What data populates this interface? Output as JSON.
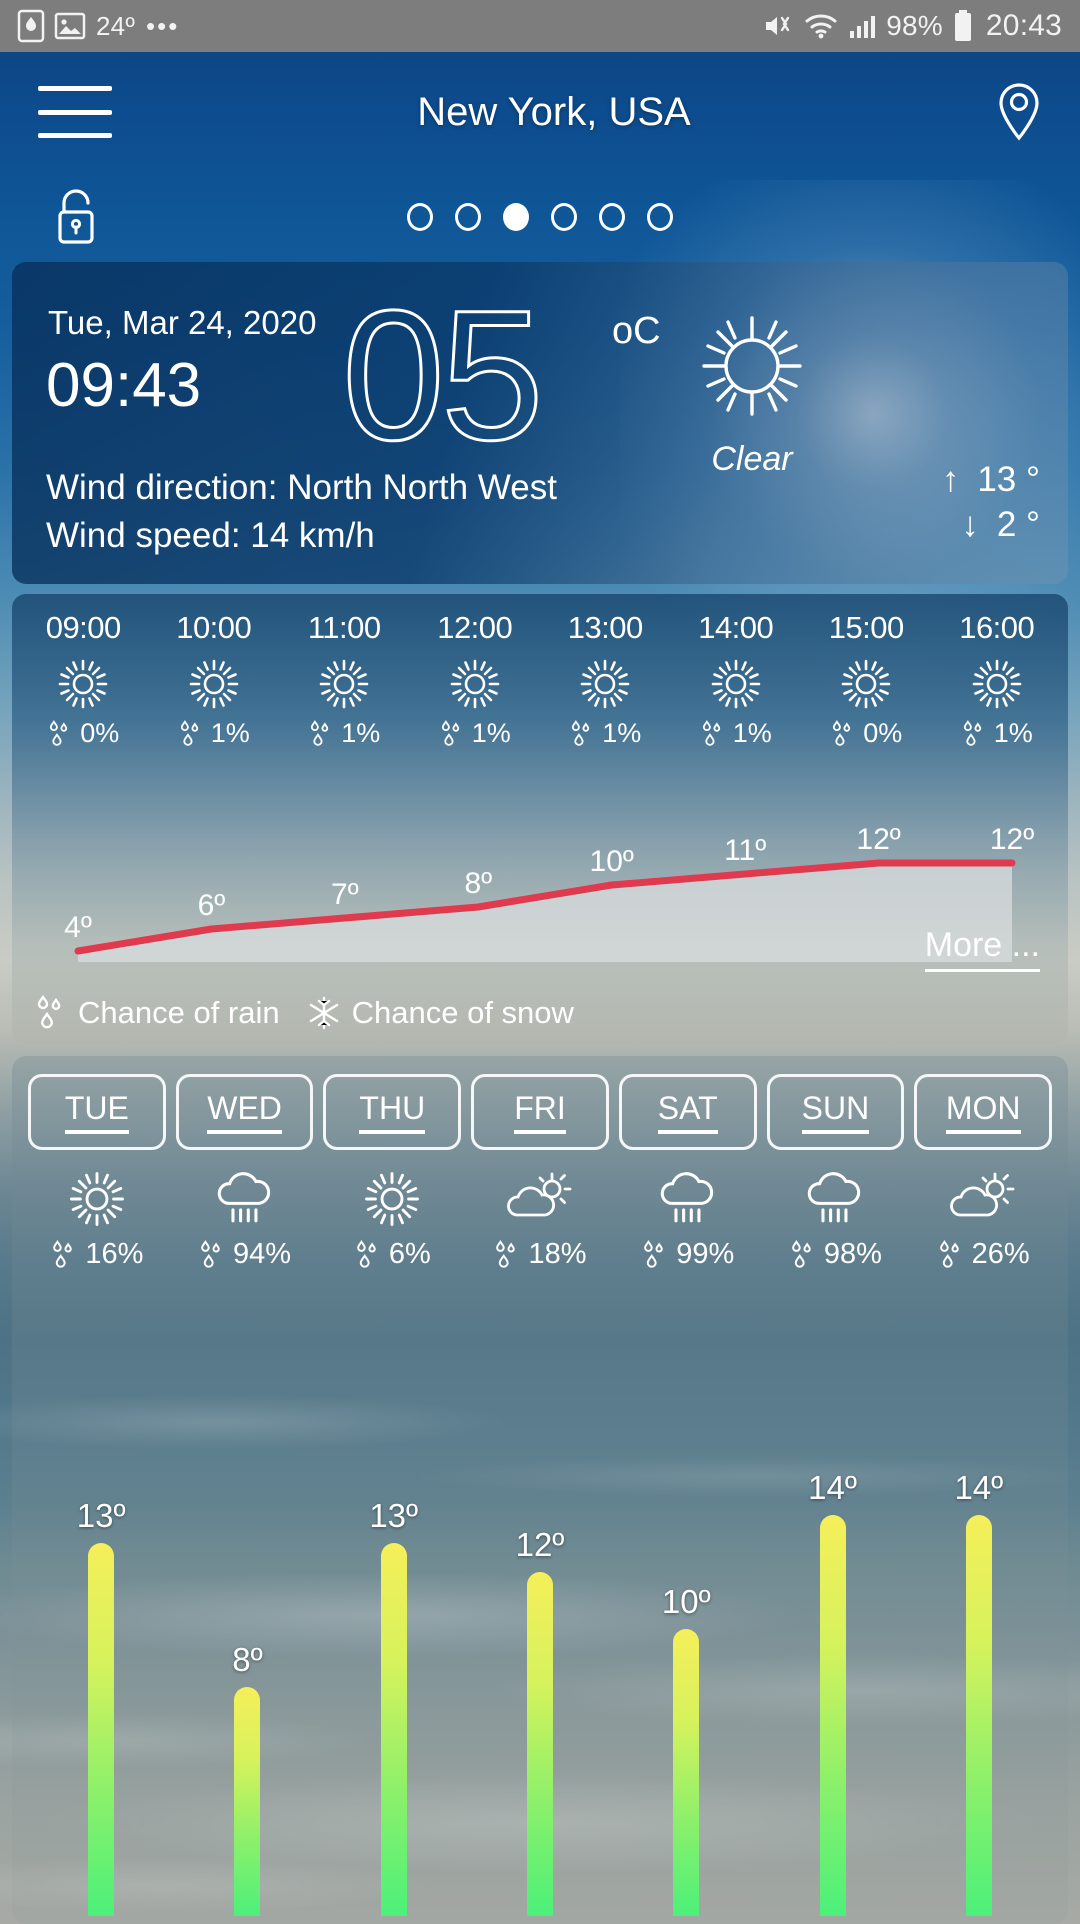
{
  "statusbar": {
    "battery_saver_icon": "battery-saver-icon",
    "photo_icon": "photo-icon",
    "notif_temp": "24º",
    "more_dots": "•••",
    "mute_icon": "volume-mute-icon",
    "wifi_icon": "wifi-icon",
    "signal_icon": "cellular-signal-icon",
    "battery_pct": "98%",
    "battery_icon": "battery-icon",
    "clock": "20:43"
  },
  "header": {
    "menu_icon": "hamburger-menu-icon",
    "title": "New York, USA",
    "location_icon": "location-pin-icon"
  },
  "subrow": {
    "lock_icon": "unlock-icon",
    "page_count": 6,
    "active_page": 3
  },
  "current": {
    "date": "Tue, Mar 24, 2020",
    "time": "09:43",
    "temperature": "05",
    "unit": "oC",
    "condition": "Clear",
    "condition_icon": "sun-icon",
    "wind_direction": "Wind direction: North North West",
    "wind_speed": "Wind speed: 14 km/h",
    "high_arrow": "↑",
    "high": "13 °",
    "low_arrow": "↓",
    "low": "2 °"
  },
  "hourly": {
    "items": [
      {
        "time": "09:00",
        "icon": "sun-icon",
        "rain": "0%"
      },
      {
        "time": "10:00",
        "icon": "sun-icon",
        "rain": "1%"
      },
      {
        "time": "11:00",
        "icon": "sun-icon",
        "rain": "1%"
      },
      {
        "time": "12:00",
        "icon": "sun-icon",
        "rain": "1%"
      },
      {
        "time": "13:00",
        "icon": "sun-icon",
        "rain": "1%"
      },
      {
        "time": "14:00",
        "icon": "sun-icon",
        "rain": "1%"
      },
      {
        "time": "15:00",
        "icon": "sun-icon",
        "rain": "0%"
      },
      {
        "time": "16:00",
        "icon": "sun-icon",
        "rain": "1%"
      }
    ],
    "legend_rain_icon": "raindrops-icon",
    "legend_rain": "Chance of rain",
    "legend_snow_icon": "snowflake-icon",
    "legend_snow": "Chance of snow",
    "more_label": "More ..."
  },
  "weekly": {
    "days": [
      {
        "label": "TUE",
        "icon": "sun-icon",
        "rain": "16%",
        "temp": "13º",
        "value": 13
      },
      {
        "label": "WED",
        "icon": "rain-cloud-icon",
        "rain": "94%",
        "temp": "8º",
        "value": 8
      },
      {
        "label": "THU",
        "icon": "sun-icon",
        "rain": "6%",
        "temp": "13º",
        "value": 13
      },
      {
        "label": "FRI",
        "icon": "sun-cloud-icon",
        "rain": "18%",
        "temp": "12º",
        "value": 12
      },
      {
        "label": "SAT",
        "icon": "rain-cloud-icon",
        "rain": "99%",
        "temp": "10º",
        "value": 10
      },
      {
        "label": "SUN",
        "icon": "rain-cloud-icon",
        "rain": "98%",
        "temp": "14º",
        "value": 14
      },
      {
        "label": "MON",
        "icon": "sun-cloud-icon",
        "rain": "26%",
        "temp": "14º",
        "value": 14
      }
    ]
  },
  "chart_data": [
    {
      "type": "area",
      "title": "Hourly temperature",
      "x": [
        "09:00",
        "10:00",
        "11:00",
        "12:00",
        "13:00",
        "14:00",
        "15:00",
        "16:00"
      ],
      "values": [
        4,
        6,
        7,
        8,
        10,
        11,
        12,
        12
      ],
      "labels": [
        "4º",
        "6º",
        "7º",
        "8º",
        "10º",
        "11º",
        "12º",
        "12º"
      ],
      "line_color": "#e03a4e",
      "fill_color": "#d7dbdc",
      "ylabel": "",
      "xlabel": "",
      "ylim": [
        0,
        14
      ],
      "grid": false,
      "legend": [
        "Chance of rain",
        "Chance of snow"
      ]
    },
    {
      "type": "bar",
      "title": "7-day high temperature",
      "categories": [
        "TUE",
        "WED",
        "THU",
        "FRI",
        "SAT",
        "SUN",
        "MON"
      ],
      "values": [
        13,
        8,
        13,
        12,
        10,
        14,
        14
      ],
      "labels": [
        "13º",
        "8º",
        "13º",
        "12º",
        "10º",
        "14º",
        "14º"
      ],
      "bar_gradient": [
        "#f5ef5a",
        "#4cf07a"
      ],
      "ylim": [
        0,
        15
      ],
      "grid": false
    }
  ]
}
